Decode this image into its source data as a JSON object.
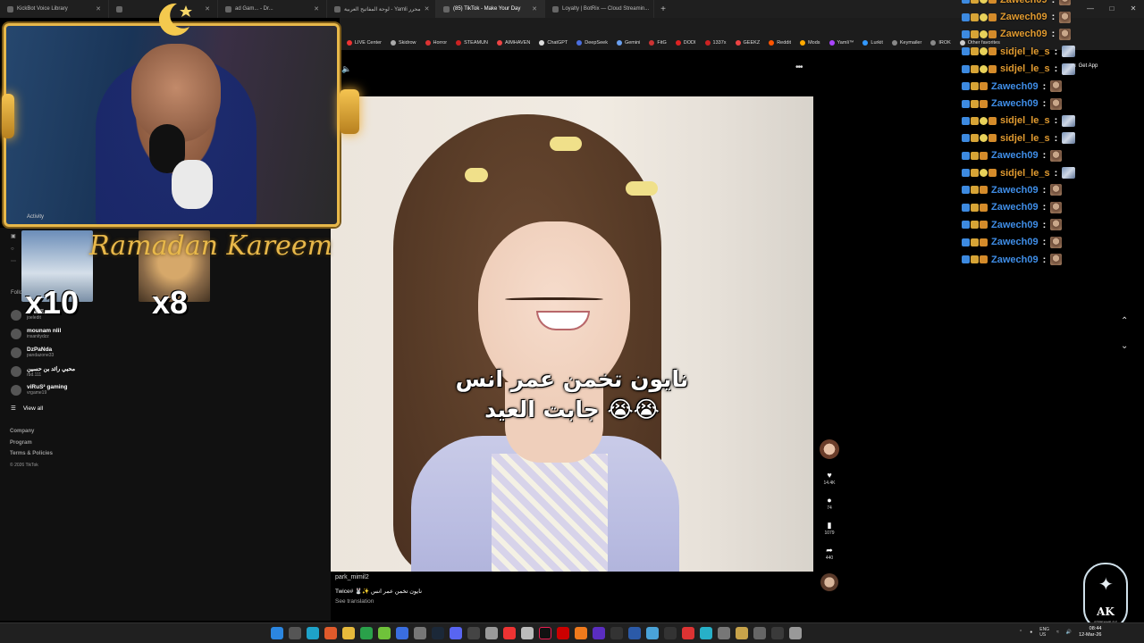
{
  "browser": {
    "tabs": [
      {
        "label": "KickBot Voice Library",
        "active": false
      },
      {
        "label": "",
        "active": false
      },
      {
        "label": "ad Gam... - Dr...",
        "active": false
      },
      {
        "label": "لوحة المفاتيح العربية - Yamli محرر",
        "active": false
      },
      {
        "label": "(85) TikTok - Make Your Day",
        "active": true
      },
      {
        "label": "Loyalty | BotRix — Cloud Streamin...",
        "active": false
      }
    ],
    "address_partial": "tiktok.com",
    "bookmarks": [
      {
        "label": "LIVE Center",
        "color": "#e33"
      },
      {
        "label": "Skidrow",
        "color": "#aaa"
      },
      {
        "label": "Horror",
        "color": "#d33"
      },
      {
        "label": "STEAMUN",
        "color": "#c22"
      },
      {
        "label": "AIMHAVEN",
        "color": "#e44"
      },
      {
        "label": "ChatGPT",
        "color": "#ddd"
      },
      {
        "label": "DeepSeek",
        "color": "#4a6ee0"
      },
      {
        "label": "Gemini",
        "color": "#6aa0f0"
      },
      {
        "label": "FitG",
        "color": "#c33"
      },
      {
        "label": "DODI",
        "color": "#d22"
      },
      {
        "label": "1337x",
        "color": "#c22"
      },
      {
        "label": "GEEKZ",
        "color": "#e44"
      },
      {
        "label": "Reddit",
        "color": "#f50"
      },
      {
        "label": "Mods",
        "color": "#fa0"
      },
      {
        "label": "Yamli™",
        "color": "#a4f"
      },
      {
        "label": "Lurkit",
        "color": "#39f"
      },
      {
        "label": "Keymailer",
        "color": "#888"
      },
      {
        "label": "IROK",
        "color": "#888"
      },
      {
        "label": "Other favorites",
        "color": "#ccc"
      }
    ]
  },
  "tiktok": {
    "activity_label": "Activity",
    "following_label": "Following accounts",
    "following": [
      {
        "name": "Joel Edit",
        "handle": "joeledit"
      },
      {
        "name": "mounam nlil",
        "handle": "insanitydzz"
      },
      {
        "name": "DzPaNda",
        "handle": "pandazone33"
      },
      {
        "name": "محبي رائد بن حسين",
        "handle": "rbd.111"
      },
      {
        "name": "viRuS² gaming",
        "handle": "vrgame19"
      }
    ],
    "view_all": "View all",
    "footer": [
      "Company",
      "Program",
      "Terms & Policies"
    ],
    "copyright": "© 2026 TikTok",
    "get_app": "Get App",
    "video": {
      "overlay_line1": "نايون تخمن عمر انس",
      "overlay_line2": "جابت العيد 😭😭",
      "author": "park_mimil2",
      "description": "Twice# 🐰✨ نايون تخمن عمر انس",
      "see_translation": "See translation",
      "likes": "14.4K",
      "comments": "74",
      "saves": "1079",
      "shares": "440"
    }
  },
  "stream_overlay": {
    "banner": "Ramadan Kareem",
    "gifts": [
      {
        "count": "x10"
      },
      {
        "count": "x8"
      }
    ],
    "logo_text": "AK",
    "logo_sub": "STREAMS DZ"
  },
  "chat": [
    {
      "user": "Zawech09",
      "color": "orange",
      "top_cut": true,
      "emote": "face"
    },
    {
      "user": "Zawech09",
      "color": "orange",
      "emote": "face"
    },
    {
      "user": "Zawech09",
      "color": "orange",
      "emote": "face"
    },
    {
      "user": "sidjel_le_s",
      "color": "orange",
      "emote": "pic"
    },
    {
      "user": "sidjel_le_s",
      "color": "orange",
      "emote": "pic"
    },
    {
      "user": "Zawech09",
      "color": "blue",
      "emote": "face"
    },
    {
      "user": "Zawech09",
      "color": "blue",
      "emote": "face"
    },
    {
      "user": "sidjel_le_s",
      "color": "orange",
      "emote": "pic"
    },
    {
      "user": "sidjel_le_s",
      "color": "orange",
      "emote": "pic"
    },
    {
      "user": "Zawech09",
      "color": "blue",
      "emote": "face"
    },
    {
      "user": "sidjel_le_s",
      "color": "orange",
      "emote": "pic"
    },
    {
      "user": "Zawech09",
      "color": "blue",
      "emote": "face"
    },
    {
      "user": "Zawech09",
      "color": "blue",
      "emote": "face"
    },
    {
      "user": "Zawech09",
      "color": "blue",
      "emote": "face"
    },
    {
      "user": "Zawech09",
      "color": "blue",
      "emote": "face"
    },
    {
      "user": "Zawech09",
      "color": "blue",
      "emote": "face"
    }
  ],
  "taskbar": {
    "lang_top": "ENG",
    "lang_bottom": "US",
    "time": "08:44",
    "date": "12-Mar-26"
  }
}
